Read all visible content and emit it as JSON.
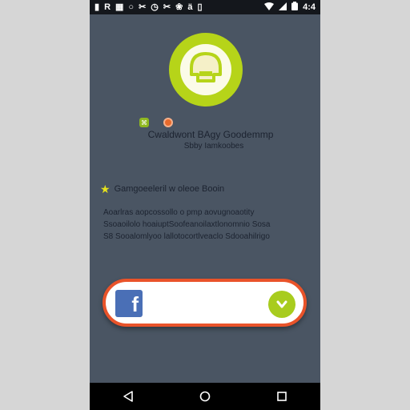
{
  "colors": {
    "background": "#4a5563",
    "accent_green": "#b6d419",
    "accent_orange": "#e9532a",
    "facebook_blue": "#4a6fb6",
    "status_bar": "#14171c"
  },
  "status_bar": {
    "left_glyphs": [
      "▮",
      "R",
      "▦",
      "○",
      "✂",
      "◷",
      "✂",
      "❀",
      "ä",
      "▯"
    ],
    "right_glyphs": [
      "wifi-icon",
      "signal-icon",
      "battery-icon"
    ],
    "time": "4:4"
  },
  "app": {
    "title": "Cwaldwont BAgy Goodemmp",
    "subtitle": "Sbby Iamkoobes"
  },
  "feature": {
    "text": "Gamgoeeleril w oleoe Booin"
  },
  "description": {
    "lines": [
      "Aoarlras aopcossollo o pmp aovugnoaotity",
      "Ssoaoilolo hoaiuptSoofeanoilaxtlonomnio Sosa",
      "S8 Sooalomlyoo lallotocortlveaclo Sdooahilrigo"
    ]
  },
  "facebook_card": {
    "icon_letter": "f",
    "icon": "facebook-icon",
    "action_icon": "chevron-down-icon"
  },
  "nav": {
    "back": "back-icon",
    "home": "home-icon",
    "recents": "recents-icon"
  }
}
